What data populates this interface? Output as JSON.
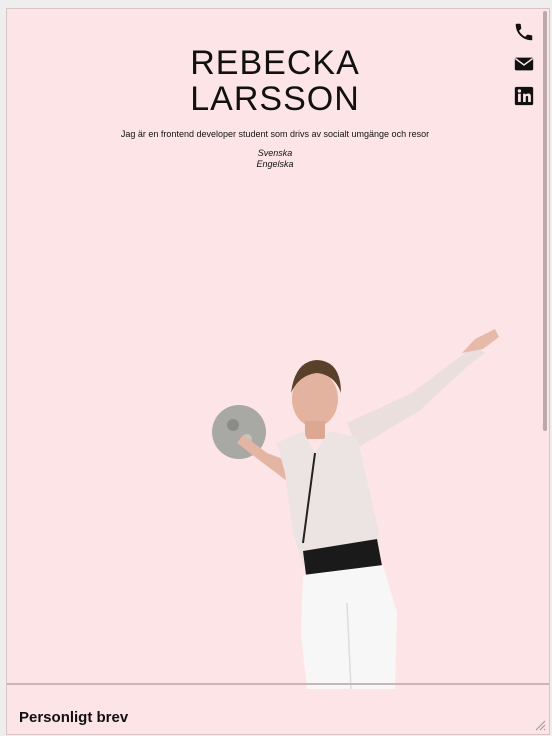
{
  "profile": {
    "first_name": "REBECKA",
    "last_name": "LARSSON",
    "tagline": "Jag är en frontend developer student som drivs av socialt umgänge och resor",
    "languages": [
      "Svenska",
      "Engelska"
    ]
  },
  "contact_icons": [
    "phone-icon",
    "envelope-icon",
    "linkedin-icon"
  ],
  "footer": {
    "section_title": "Personligt brev"
  },
  "colors": {
    "background": "#fde4e7",
    "text": "#111111"
  }
}
